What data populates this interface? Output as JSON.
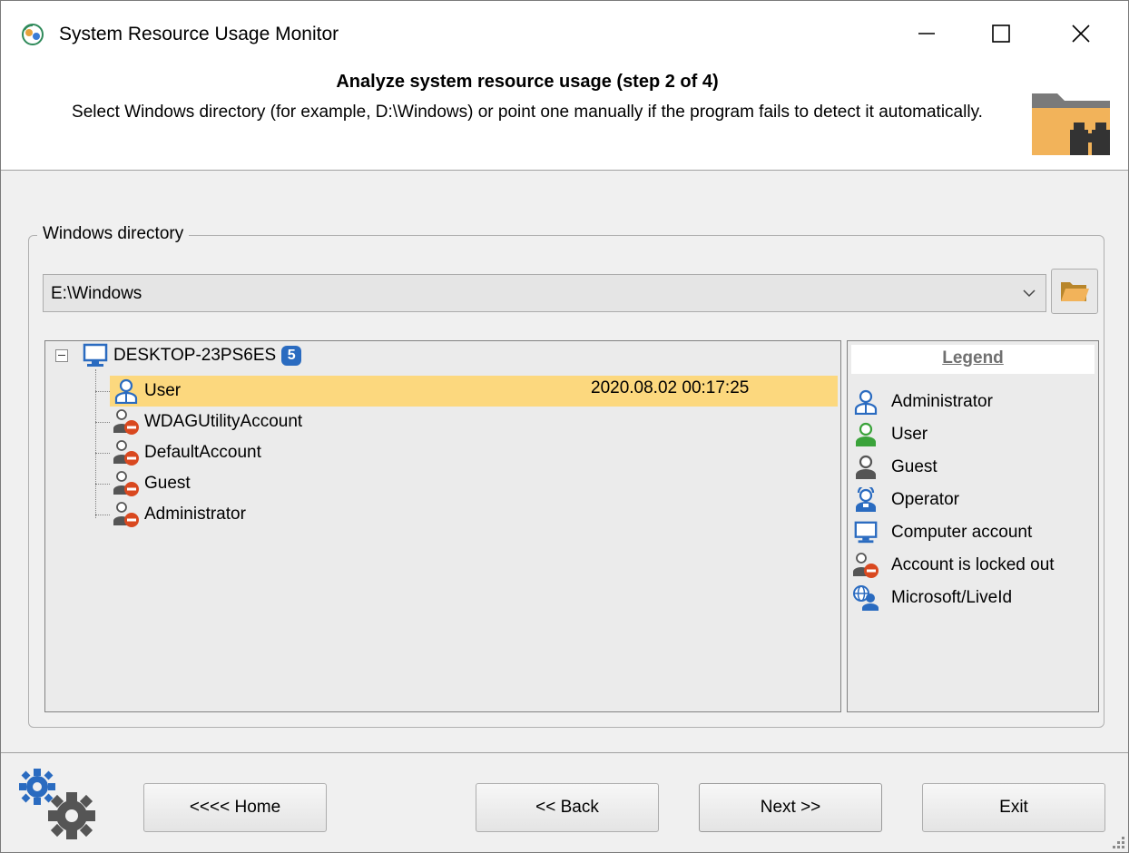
{
  "window": {
    "title": "System Resource Usage Monitor",
    "controls": {
      "minimize": "minimize-icon",
      "maximize": "maximize-icon",
      "close": "close-icon"
    }
  },
  "header": {
    "step_title": "Analyze system resource usage (step 2 of 4)",
    "description": "Select Windows directory (for example, D:\\Windows) or point one manually if the program fails to detect it automatically."
  },
  "group": {
    "label": "Windows directory",
    "directory_value": "E:\\Windows"
  },
  "tree": {
    "root": {
      "label": "DESKTOP-23PS6ES",
      "count": "5",
      "icon": "computer-icon"
    },
    "items": [
      {
        "label": "User",
        "date": "2020.08.02 00:17:25",
        "icon": "administrator-icon",
        "selected": true
      },
      {
        "label": "WDAGUtilityAccount",
        "date": "",
        "icon": "locked-out-icon",
        "selected": false
      },
      {
        "label": "DefaultAccount",
        "date": "",
        "icon": "locked-out-icon",
        "selected": false
      },
      {
        "label": "Guest",
        "date": "",
        "icon": "locked-out-icon",
        "selected": false
      },
      {
        "label": "Administrator",
        "date": "",
        "icon": "locked-out-icon",
        "selected": false
      }
    ]
  },
  "legend": {
    "title": "Legend",
    "items": [
      {
        "label": "Administrator",
        "icon": "administrator-icon"
      },
      {
        "label": "User",
        "icon": "user-icon"
      },
      {
        "label": "Guest",
        "icon": "guest-icon"
      },
      {
        "label": "Operator",
        "icon": "operator-icon"
      },
      {
        "label": "Computer account",
        "icon": "computer-icon"
      },
      {
        "label": "Account is locked out",
        "icon": "locked-out-icon"
      },
      {
        "label": "Microsoft/LiveId",
        "icon": "microsoft-liveid-icon"
      }
    ]
  },
  "buttons": {
    "home": "<<<< Home",
    "back": "<< Back",
    "next": "Next >>",
    "exit": "Exit"
  },
  "colors": {
    "selection": "#fcd87e",
    "admin_blue": "#2a6bc0",
    "user_green": "#3aa33a",
    "lock_red": "#d9481f",
    "folder_orange": "#f2b35a"
  }
}
